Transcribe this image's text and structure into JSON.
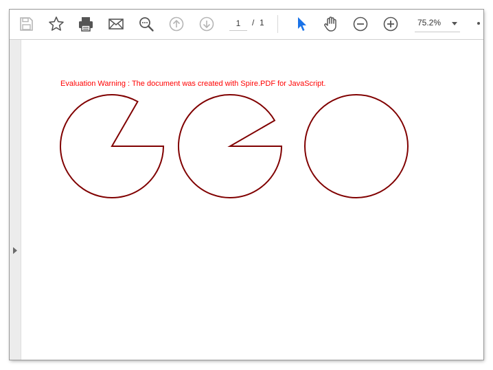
{
  "toolbar": {
    "buttons": [
      {
        "name": "save-button",
        "icon": "save-icon",
        "enabled": false
      },
      {
        "name": "bookmark-button",
        "icon": "star-icon",
        "enabled": true
      },
      {
        "name": "print-button",
        "icon": "printer-icon",
        "enabled": true
      },
      {
        "name": "email-button",
        "icon": "mail-icon",
        "enabled": true
      },
      {
        "name": "find-button",
        "icon": "search-icon",
        "enabled": true
      },
      {
        "name": "previous-page-button",
        "icon": "arrow-up-circle-icon",
        "enabled": false
      },
      {
        "name": "next-page-button",
        "icon": "arrow-down-circle-icon",
        "enabled": false
      },
      {
        "name": "select-tool-button",
        "icon": "cursor-icon",
        "enabled": true,
        "active": true
      },
      {
        "name": "hand-tool-button",
        "icon": "hand-icon",
        "enabled": true
      },
      {
        "name": "zoom-out-button",
        "icon": "minus-circle-icon",
        "enabled": true
      },
      {
        "name": "zoom-in-button",
        "icon": "plus-circle-icon",
        "enabled": true
      }
    ],
    "page_current": "1",
    "page_separator": "/",
    "page_total": "1",
    "zoom": "75.2%"
  },
  "document": {
    "warning_text": "Evaluation Warning : The document was created with Spire.PDF for JavaScript.",
    "warning_color": "#ff0000",
    "shape_stroke_color": "#800000",
    "shape_fill_color": "#ffffff",
    "shapes": [
      {
        "type": "pie",
        "open_angle_start_deg": 0,
        "open_angle_end_deg": 300,
        "missing_sector_deg": 60
      },
      {
        "type": "pie",
        "open_angle_start_deg": 0,
        "open_angle_end_deg": 330,
        "missing_sector_deg": 30
      },
      {
        "type": "circle"
      }
    ]
  },
  "colors": {
    "active_tool": "#1a73e8",
    "icon": "#555555",
    "icon_disabled": "#b5b5b5"
  }
}
